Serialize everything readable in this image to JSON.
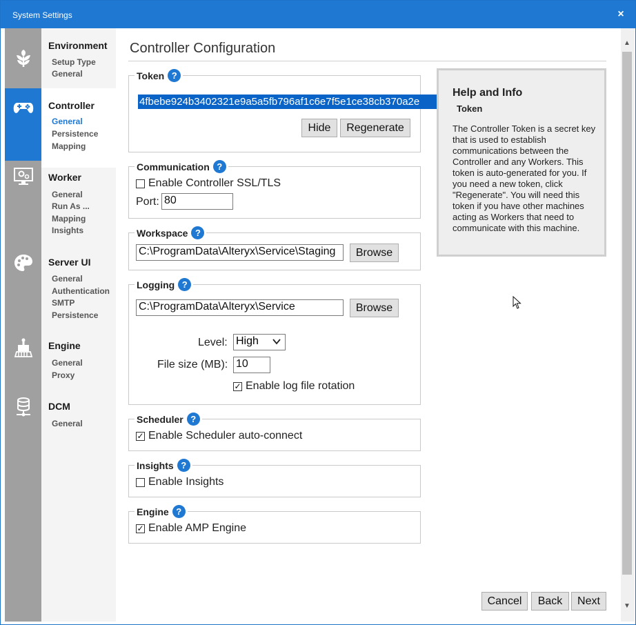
{
  "window": {
    "title": "System Settings",
    "close": "×"
  },
  "nav": [
    {
      "heading": "Environment",
      "icon": "leaf-icon",
      "items": [
        "Setup Type",
        "General"
      ]
    },
    {
      "heading": "Controller",
      "icon": "gamepad-icon",
      "items": [
        "General",
        "Persistence",
        "Mapping"
      ],
      "selected": "General"
    },
    {
      "heading": "Worker",
      "icon": "monitor-gear-icon",
      "items": [
        "General",
        "Run As ...",
        "Mapping",
        "Insights"
      ]
    },
    {
      "heading": "Server UI",
      "icon": "palette-icon",
      "items": [
        "General",
        "Authentication",
        "SMTP",
        "Persistence"
      ]
    },
    {
      "heading": "Engine",
      "icon": "engine-icon",
      "items": [
        "General",
        "Proxy"
      ]
    },
    {
      "heading": "DCM",
      "icon": "database-icon",
      "items": [
        "General"
      ]
    }
  ],
  "page": {
    "title": "Controller Configuration"
  },
  "token": {
    "legend": "Token",
    "value": "4fbebe924b3402321e9a5a5fb796af1c6e7f5e1ce38cb370a2e",
    "hide": "Hide",
    "regenerate": "Regenerate"
  },
  "communication": {
    "legend": "Communication",
    "ssl_label": "Enable Controller SSL/TLS",
    "ssl_checked": false,
    "port_label": "Port:",
    "port_value": "80"
  },
  "workspace": {
    "legend": "Workspace",
    "path": "C:\\ProgramData\\Alteryx\\Service\\Staging",
    "browse": "Browse"
  },
  "logging": {
    "legend": "Logging",
    "path": "C:\\ProgramData\\Alteryx\\Service",
    "browse": "Browse",
    "level_label": "Level:",
    "level_value": "High",
    "filesize_label": "File size (MB):",
    "filesize_value": "10",
    "rotation_label": "Enable log file rotation",
    "rotation_checked": true
  },
  "scheduler": {
    "legend": "Scheduler",
    "label": "Enable Scheduler auto-connect",
    "checked": true
  },
  "insights": {
    "legend": "Insights",
    "label": "Enable Insights",
    "checked": false
  },
  "engine": {
    "legend": "Engine",
    "label": "Enable AMP Engine",
    "checked": true
  },
  "help": {
    "title": "Help and Info",
    "subtitle": "Token",
    "body": "The Controller Token is a secret key that is used to establish communications between the Controller and any Workers. This token is auto-generated for you. If you need a new token, click \"Regenerate\". You will need this token if you have other machines acting as Workers that need to communicate with this machine."
  },
  "footer": {
    "cancel": "Cancel",
    "back": "Back",
    "next": "Next"
  },
  "help_icon_text": "?",
  "check_mark": "✓",
  "colors": {
    "accent": "#1f78d1",
    "rail": "#a0a0a0",
    "selection": "#0a64c8"
  }
}
